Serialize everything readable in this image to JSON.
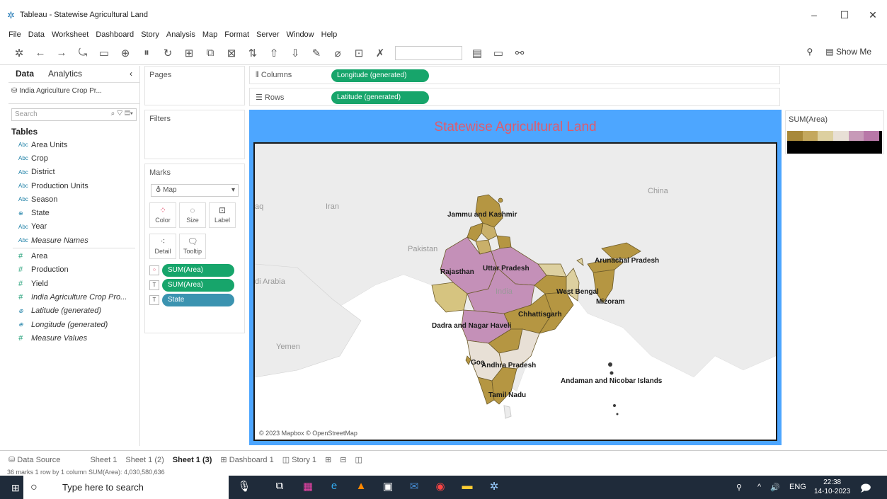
{
  "window": {
    "title": "Tableau - Statewise Agricultural Land",
    "min": "–",
    "max": "☐",
    "close": "✕"
  },
  "menu": [
    "File",
    "Data",
    "Worksheet",
    "Dashboard",
    "Story",
    "Analysis",
    "Map",
    "Format",
    "Server",
    "Window",
    "Help"
  ],
  "toolbar": {
    "show_me": "Show Me"
  },
  "data_pane": {
    "tabs": [
      "Data",
      "Analytics"
    ],
    "datasource": "India Agriculture Crop Pr...",
    "search_placeholder": "Search",
    "tables_label": "Tables",
    "fields": [
      {
        "type": "Abc",
        "name": "Area Units"
      },
      {
        "type": "Abc",
        "name": "Crop"
      },
      {
        "type": "Abc",
        "name": "District"
      },
      {
        "type": "Abc",
        "name": "Production Units"
      },
      {
        "type": "Abc",
        "name": "Season"
      },
      {
        "type": "globe",
        "name": "State"
      },
      {
        "type": "Abc",
        "name": "Year"
      },
      {
        "type": "Abc",
        "name": "Measure Names",
        "italic": true
      },
      {
        "type": "#",
        "name": "Area"
      },
      {
        "type": "#",
        "name": "Production"
      },
      {
        "type": "#",
        "name": "Yield"
      },
      {
        "type": "#",
        "name": "India Agriculture Crop Pro...",
        "italic": true
      },
      {
        "type": "globe",
        "name": "Latitude (generated)",
        "italic": true
      },
      {
        "type": "globe",
        "name": "Longitude (generated)",
        "italic": true
      },
      {
        "type": "#",
        "name": "Measure Values",
        "italic": true
      }
    ]
  },
  "cards": {
    "pages": "Pages",
    "filters": "Filters",
    "marks": "Marks",
    "mark_type": "Map",
    "buttons": [
      "Color",
      "Size",
      "Label",
      "Detail",
      "Tooltip"
    ],
    "pills": [
      "SUM(Area)",
      "SUM(Area)",
      "State"
    ]
  },
  "shelves": {
    "columns_label": "Columns",
    "columns_pill": "Longitude (generated)",
    "rows_label": "Rows",
    "rows_pill": "Latitude (generated)"
  },
  "viz": {
    "title": "Statewise Agricultural Land",
    "copyright": "© 2023 Mapbox © OpenStreetMap",
    "bg_labels": [
      "China",
      "Iran",
      "Pakistan",
      "di Arabia",
      "Yemen",
      "aq",
      "India"
    ],
    "state_labels": [
      "Jammu and Kashmir",
      "Rajasthan",
      "Uttar Pradesh",
      "Arunachal Pradesh",
      "West Bengal",
      "Mizoram",
      "Chhattisgarh",
      "Dadra and Nagar Haveli",
      "Goa",
      "Andhra Pradesh",
      "Tamil Nadu",
      "Andaman and Nicobar Islands"
    ]
  },
  "legend": {
    "title": "SUM(Area)",
    "colors": [
      "#a8893a",
      "#c4a85e",
      "#ddd0a0",
      "#e8e0d6",
      "#c79ab8",
      "#b878a8"
    ]
  },
  "sheet_tabs": [
    "Data Source",
    "Sheet 1",
    "Sheet 1 (2)",
    "Sheet 1 (3)",
    "Dashboard 1",
    "Story 1"
  ],
  "status": "36 marks    1 row by 1 column    SUM(Area): 4,030,580,636",
  "taskbar": {
    "search": "Type here to search",
    "lang": "ENG",
    "time": "22:38",
    "date": "14-10-2023"
  }
}
